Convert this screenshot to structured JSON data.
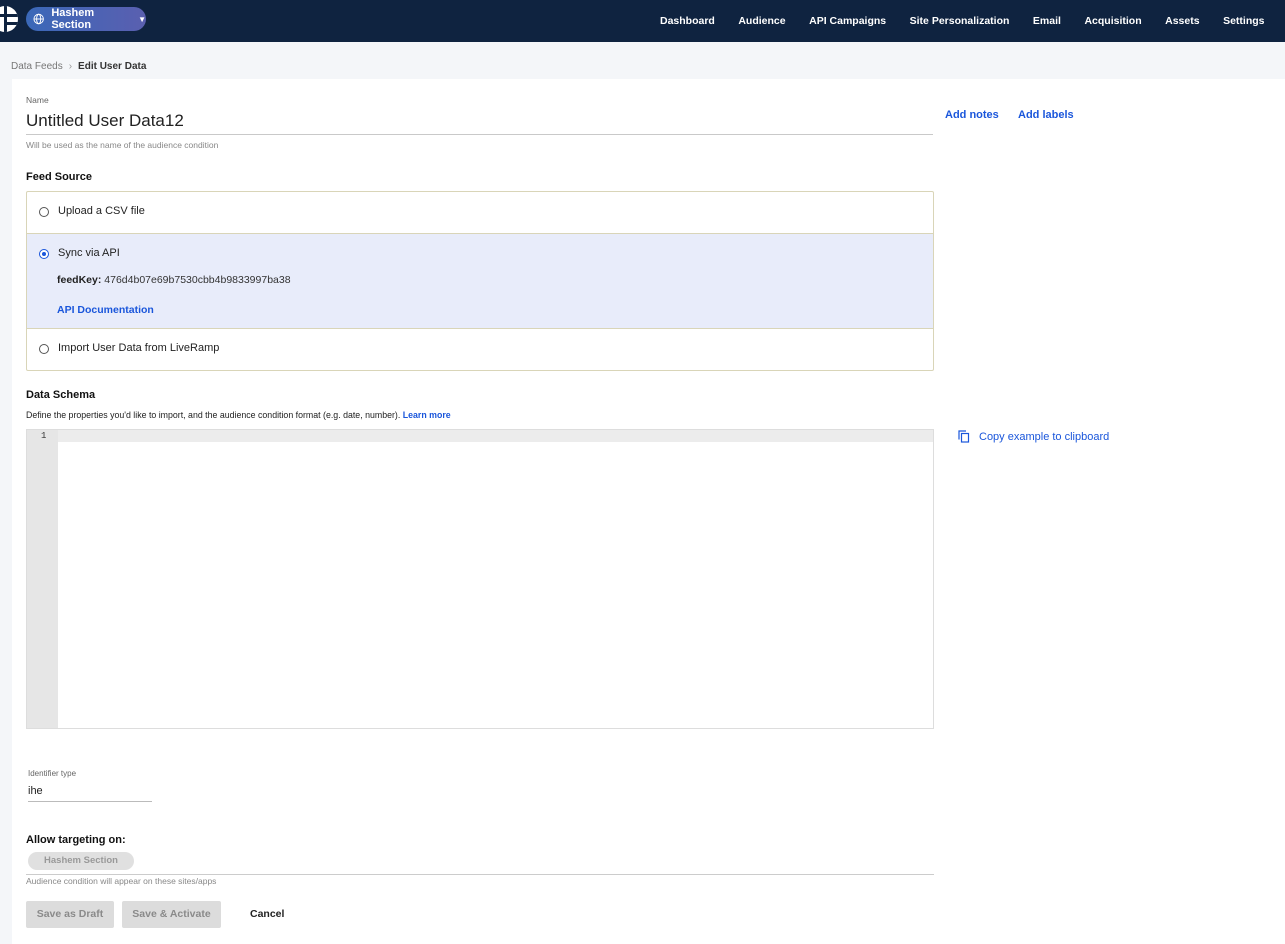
{
  "nav": {
    "site": "Hashem Section",
    "items": [
      "Dashboard",
      "Audience",
      "API Campaigns",
      "Site Personalization",
      "Email",
      "Acquisition",
      "Assets",
      "Settings"
    ]
  },
  "breadcrumb": {
    "parent": "Data Feeds",
    "current": "Edit User Data"
  },
  "form": {
    "name_label": "Name",
    "name_value": "Untitled User Data12",
    "name_hint": "Will be used as the name of the audience condition",
    "add_notes": "Add notes",
    "add_labels": "Add labels",
    "feed_source_title": "Feed Source",
    "options": {
      "csv": "Upload a CSV file",
      "api": "Sync via API",
      "liveramp": "Import User Data from LiveRamp"
    },
    "selected_option": "api",
    "feedkey_label": "feedKey:",
    "feedkey_value": "476d4b07e69b7530cbb4b9833997ba38",
    "api_doc_link": "API Documentation",
    "schema_title": "Data Schema",
    "schema_desc": "Define the properties you'd like to import, and the audience condition format (e.g. date, number).",
    "learn_more": "Learn more",
    "editor_line_number": "1",
    "copy_example": "Copy example to clipboard",
    "identifier_label": "Identifier type",
    "identifier_value": "ihe",
    "targeting_title": "Allow targeting on:",
    "targeting_chip": "Hashem Section",
    "targeting_hint": "Audience condition will appear on these sites/apps",
    "save_draft": "Save as Draft",
    "save_activate": "Save & Activate",
    "cancel": "Cancel"
  },
  "colors": {
    "nav_bg": "#0f2340",
    "link": "#1a56db",
    "selected_option_bg": "#e8ecfa"
  },
  "icons": {
    "site_pill": "globe-icon",
    "copy": "copy-icon",
    "breadcrumb_separator": "chevron-right-icon"
  }
}
